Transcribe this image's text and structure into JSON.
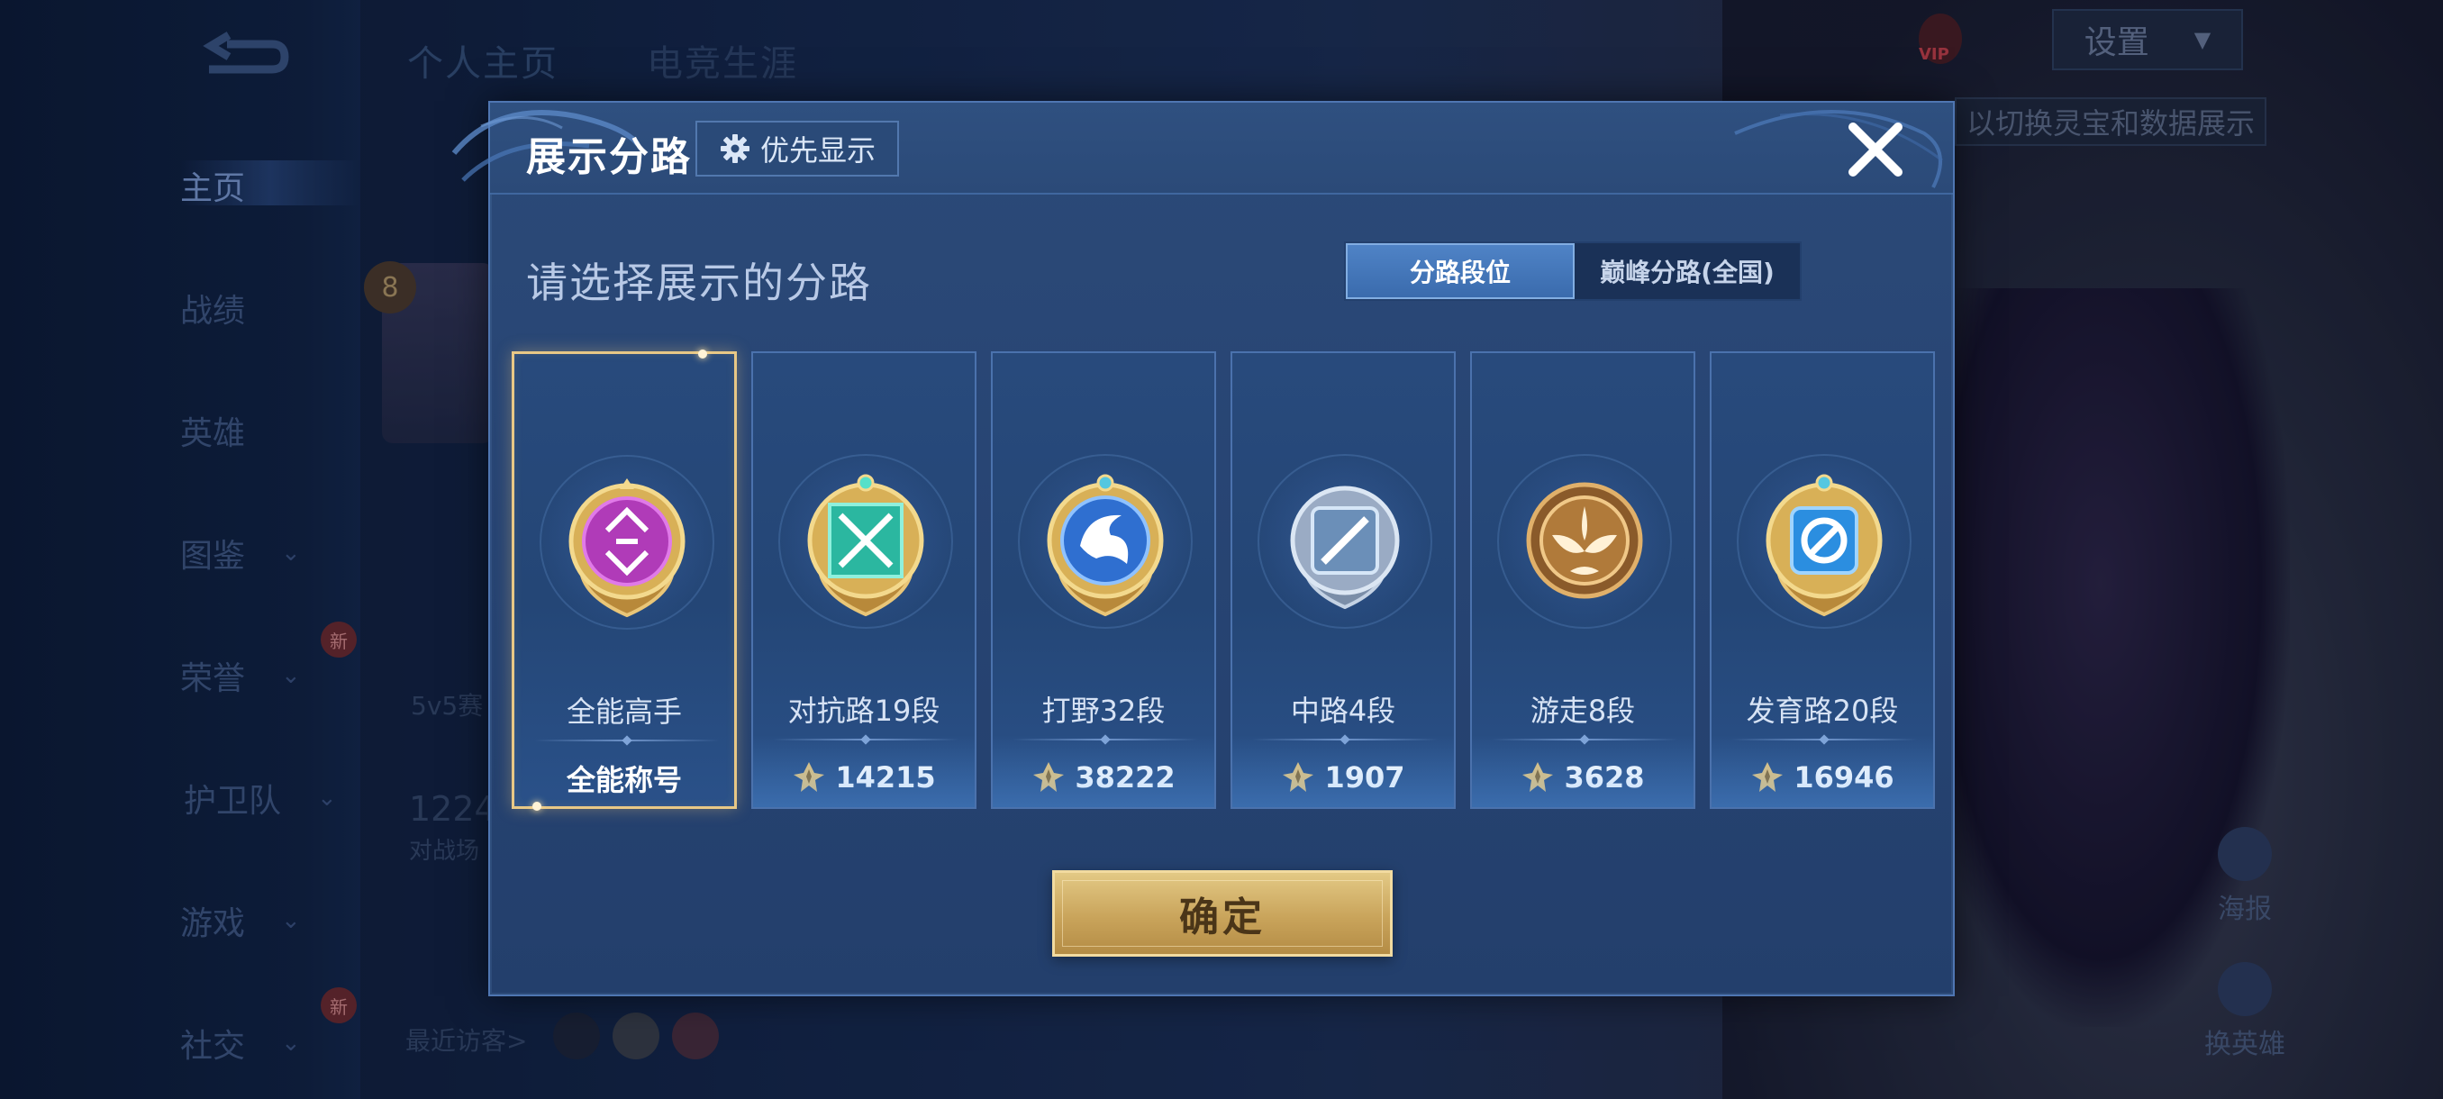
{
  "background": {
    "top_tabs": [
      "个人主页",
      "电竞生涯"
    ],
    "sidebar": [
      {
        "label": "主页",
        "active": true
      },
      {
        "label": "战绩"
      },
      {
        "label": "英雄"
      },
      {
        "label": "图鉴",
        "chevron": true
      },
      {
        "label": "荣誉",
        "chevron": true,
        "badge": "新"
      },
      {
        "label": "护卫队",
        "chevron": true
      },
      {
        "label": "游戏",
        "chevron": true
      },
      {
        "label": "社交",
        "chevron": true,
        "badge": "新"
      }
    ],
    "settings_label": "设置",
    "vip_label": "VIP",
    "tip_text": "以切换灵宝和数据展示",
    "recent_visitors_label": "最近访客>",
    "mode_text": "5v5赛",
    "stat_number": "1224",
    "stat_label": "对战场",
    "profile_level": "8",
    "right_buttons": [
      "海报",
      "换英雄"
    ]
  },
  "modal": {
    "title": "展示分路",
    "priority_label": "优先显示",
    "subtitle": "请选择展示的分路",
    "toggles": [
      {
        "label": "分路段位",
        "active": true
      },
      {
        "label": "巅峰分路(全国)",
        "active": false
      }
    ],
    "cards": [
      {
        "label": "全能高手",
        "value": "全能称号",
        "show_icon": false,
        "selected": true,
        "badge_color": "#b03bb8"
      },
      {
        "label": "对抗路19段",
        "value": "14215",
        "show_icon": true,
        "selected": false,
        "badge_color": "#2bb7a0"
      },
      {
        "label": "打野32段",
        "value": "38222",
        "show_icon": true,
        "selected": false,
        "badge_color": "#2f6fd0"
      },
      {
        "label": "中路4段",
        "value": "1907",
        "show_icon": true,
        "selected": false,
        "badge_color": "#6b8fb8"
      },
      {
        "label": "游走8段",
        "value": "3628",
        "show_icon": true,
        "selected": false,
        "badge_color": "#b07a3a"
      },
      {
        "label": "发育路20段",
        "value": "16946",
        "show_icon": true,
        "selected": false,
        "badge_color": "#2b8ee0"
      }
    ],
    "confirm_label": "确定"
  }
}
